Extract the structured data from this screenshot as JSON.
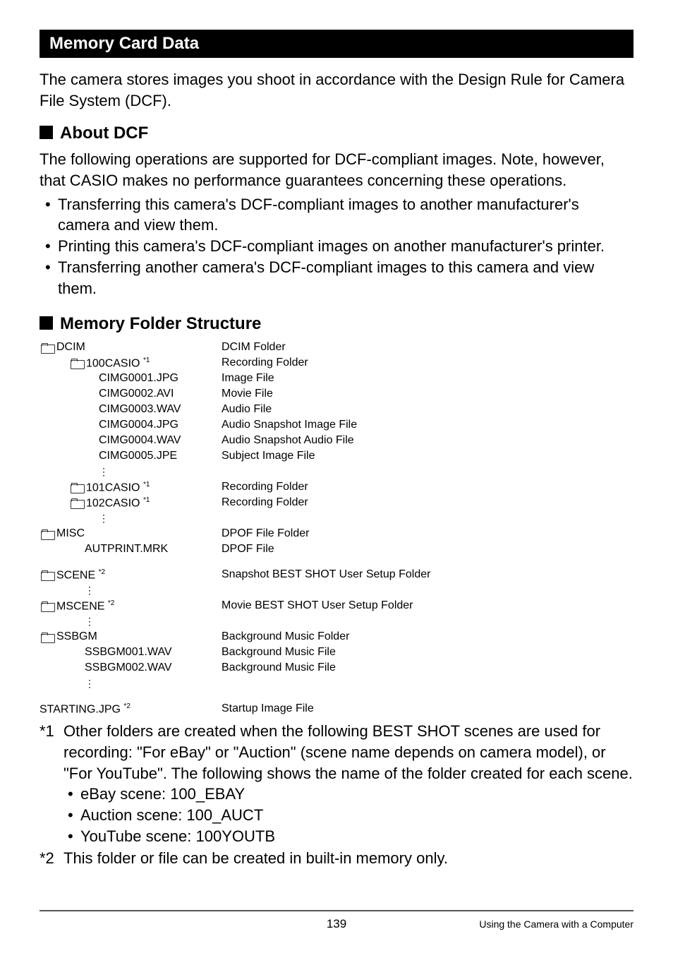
{
  "section_title": "Memory Card Data",
  "intro": "The camera stores images you shoot in accordance with the Design Rule for Camera File System (DCF).",
  "about_dcf_heading": "About DCF",
  "about_dcf_text": "The following operations are supported for DCF-compliant images. Note, however, that CASIO makes no performance guarantees concerning these operations.",
  "dcf_bullets": [
    "Transferring this camera's DCF-compliant images to another manufacturer's camera and view them.",
    "Printing this camera's DCF-compliant images on another manufacturer's printer.",
    "Transferring another camera's DCF-compliant images to this camera and view them."
  ],
  "folder_heading": "Memory Folder Structure",
  "tree": [
    {
      "indent": "indent-0",
      "folder": true,
      "label": "DCIM",
      "sup": "",
      "desc": "DCIM Folder"
    },
    {
      "indent": "indent-1f",
      "folder": true,
      "label": "100CASIO ",
      "sup": "*1",
      "desc": "Recording Folder"
    },
    {
      "indent": "indent-2",
      "folder": false,
      "label": "CIMG0001.JPG",
      "sup": "",
      "desc": "Image File"
    },
    {
      "indent": "indent-2",
      "folder": false,
      "label": "CIMG0002.AVI",
      "sup": "",
      "desc": "Movie File"
    },
    {
      "indent": "indent-2",
      "folder": false,
      "label": "CIMG0003.WAV",
      "sup": "",
      "desc": "Audio File"
    },
    {
      "indent": "indent-2",
      "folder": false,
      "label": "CIMG0004.JPG",
      "sup": "",
      "desc": "Audio Snapshot Image File"
    },
    {
      "indent": "indent-2",
      "folder": false,
      "label": "CIMG0004.WAV",
      "sup": "",
      "desc": "Audio Snapshot Audio File"
    },
    {
      "indent": "indent-2",
      "folder": false,
      "label": "CIMG0005.JPE",
      "sup": "",
      "desc": "Subject Image File"
    },
    {
      "indent": "indent-2",
      "folder": false,
      "label": "",
      "sup": "",
      "desc": "",
      "vdots": true
    },
    {
      "indent": "indent-1f",
      "folder": true,
      "label": "101CASIO ",
      "sup": "*1",
      "desc": "Recording Folder"
    },
    {
      "indent": "indent-1f",
      "folder": true,
      "label": "102CASIO ",
      "sup": "*1",
      "desc": "Recording Folder"
    },
    {
      "indent": "indent-2",
      "folder": false,
      "label": "",
      "sup": "",
      "desc": "",
      "vdots": true
    },
    {
      "indent": "indent-0",
      "folder": true,
      "label": "MISC",
      "sup": "",
      "desc": "DPOF File Folder"
    },
    {
      "indent": "indent-1",
      "folder": false,
      "label": "AUTPRINT.MRK",
      "sup": "",
      "desc": "DPOF File"
    },
    {
      "indent": "indent-0",
      "folder": false,
      "label": "",
      "sup": "",
      "desc": "",
      "spacer": true
    },
    {
      "indent": "indent-0",
      "folder": true,
      "label": "SCENE ",
      "sup": "*2",
      "desc": "Snapshot BEST SHOT User Setup Folder"
    },
    {
      "indent": "indent-1",
      "folder": false,
      "label": "",
      "sup": "",
      "desc": "",
      "vdots": true
    },
    {
      "indent": "indent-0",
      "folder": true,
      "label": "MSCENE ",
      "sup": "*2",
      "desc": "Movie BEST SHOT User Setup Folder"
    },
    {
      "indent": "indent-1",
      "folder": false,
      "label": "",
      "sup": "",
      "desc": "",
      "vdots": true
    },
    {
      "indent": "indent-0",
      "folder": true,
      "label": "SSBGM",
      "sup": "",
      "desc": "Background Music Folder"
    },
    {
      "indent": "indent-1",
      "folder": false,
      "label": "SSBGM001.WAV",
      "sup": "",
      "desc": "Background Music File"
    },
    {
      "indent": "indent-1",
      "folder": false,
      "label": "SSBGM002.WAV",
      "sup": "",
      "desc": "Background Music File"
    },
    {
      "indent": "indent-1",
      "folder": false,
      "label": "",
      "sup": "",
      "desc": "",
      "vdots": true
    }
  ],
  "starting_label": "STARTING.JPG ",
  "starting_sup": "*2",
  "starting_desc": "Startup Image File",
  "note1_mark": "*1",
  "note1_text": "Other folders are created when the following BEST SHOT scenes are used for recording: \"For eBay\" or \"Auction\" (scene name depends on camera model), or \"For YouTube\". The following shows the name of the folder created for each scene.",
  "note1_bullets": [
    "eBay scene: 100_EBAY",
    "Auction scene: 100_AUCT",
    "YouTube scene: 100YOUTB"
  ],
  "note2_mark": "*2",
  "note2_text": "This folder or file can be created in built-in memory only.",
  "page_number": "139",
  "footer_text": "Using the Camera with a Computer"
}
